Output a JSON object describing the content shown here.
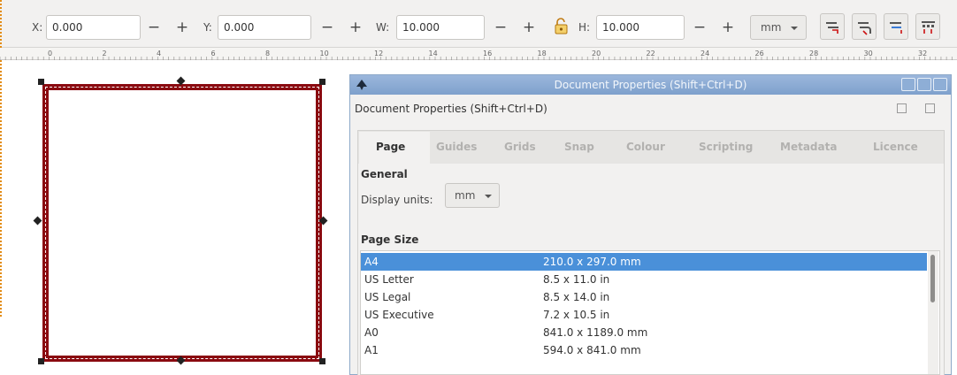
{
  "toolbar": {
    "x_label": "X:",
    "x_value": "0.000",
    "y_label": "Y:",
    "y_value": "0.000",
    "w_label": "W:",
    "w_value": "10.000",
    "h_label": "H:",
    "h_value": "10.000",
    "minus": "−",
    "plus": "+",
    "units": "mm"
  },
  "ruler": {
    "labels": [
      "0",
      "2",
      "4",
      "6",
      "8",
      "10",
      "12",
      "14",
      "16",
      "18",
      "20",
      "22",
      "24",
      "26",
      "28",
      "30",
      "32"
    ]
  },
  "dialog": {
    "title": "Document Properties (Shift+Ctrl+D)",
    "docked_title": "Document Properties (Shift+Ctrl+D)",
    "tabs": [
      "Page",
      "Guides",
      "Grids",
      "Snap",
      "Colour",
      "Scripting",
      "Metadata",
      "Licence"
    ],
    "active_tab": "Page",
    "general_heading": "General",
    "display_units_label": "Display units:",
    "display_units_value": "mm",
    "page_size_heading": "Page Size",
    "page_sizes": [
      {
        "name": "A4",
        "size": "210.0 x 297.0 mm",
        "selected": true
      },
      {
        "name": "US Letter",
        "size": "8.5 x 11.0 in",
        "selected": false
      },
      {
        "name": "US Legal",
        "size": "8.5 x 14.0 in",
        "selected": false
      },
      {
        "name": "US Executive",
        "size": "7.2 x 10.5 in",
        "selected": false
      },
      {
        "name": "A0",
        "size": "841.0 x 1189.0 mm",
        "selected": false
      },
      {
        "name": "A1",
        "size": "594.0 x 841.0 mm",
        "selected": false
      }
    ]
  },
  "colors": {
    "page_border": "#8a0a10",
    "selection": "#4a90d9",
    "titlebar": "#7ea0cc",
    "guide_dots": "#e38c14"
  }
}
